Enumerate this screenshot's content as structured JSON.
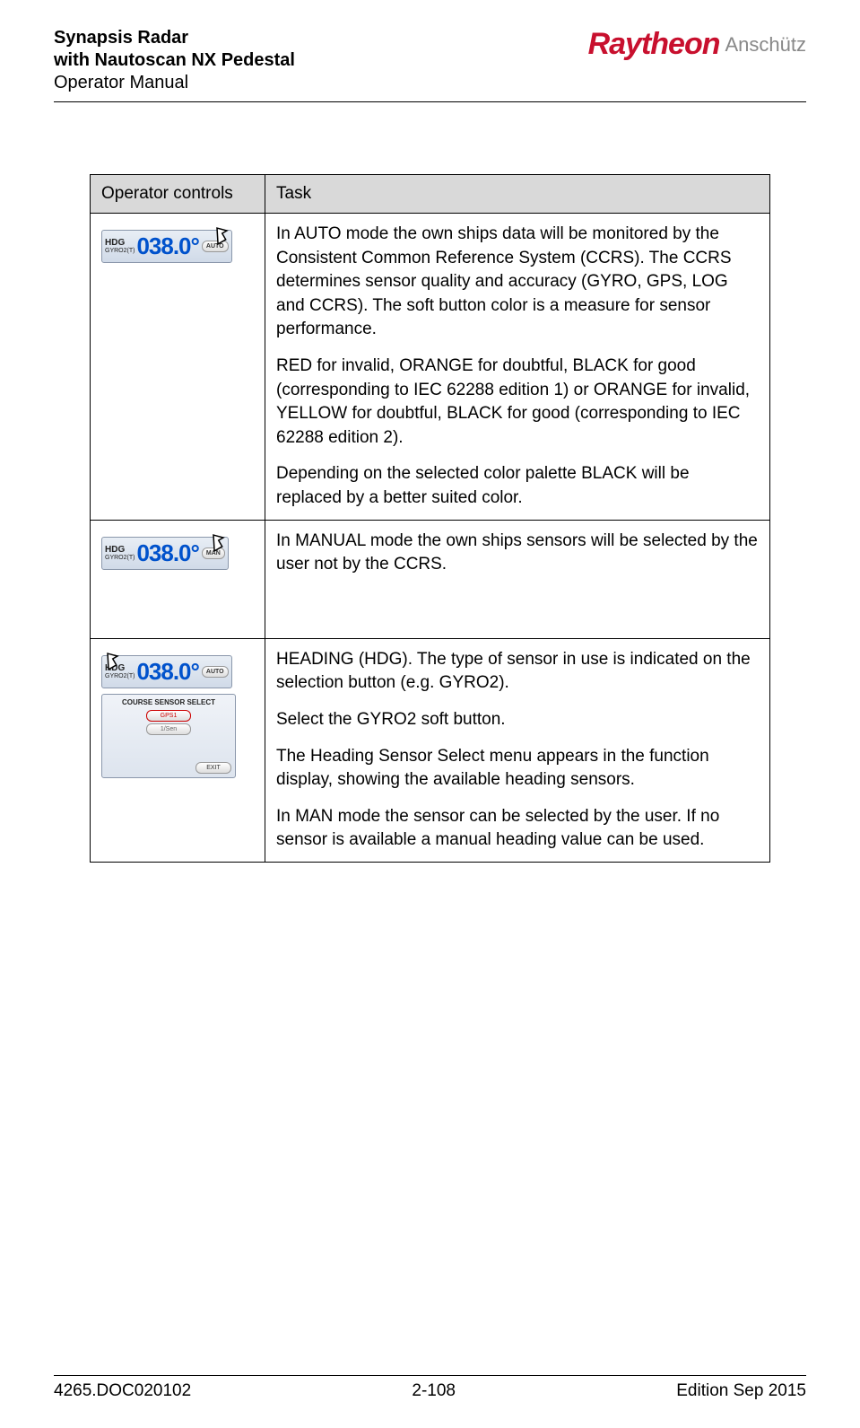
{
  "header": {
    "title_line1": "Synapsis Radar",
    "title_line2": "with Nautoscan NX Pedestal",
    "subtitle": "Operator Manual",
    "brand_main": "Raytheon",
    "brand_sub": "Anschütz"
  },
  "table": {
    "header_col1": "Operator controls",
    "header_col2": "Task",
    "rows": [
      {
        "widget": {
          "hdg_label": "HDG",
          "gyro_label": "GYRO2(T)",
          "value": "038.0°",
          "mode": "AUTO",
          "cursor_pos": "right"
        },
        "task_paragraphs": [
          "In AUTO mode the own ships data will be monitored by the Consistent Common Reference System (CCRS). The CCRS determines sensor quality and accuracy (GYRO, GPS, LOG and CCRS). The soft button color is a measure for sensor performance.",
          "RED for invalid, ORANGE for doubtful, BLACK for good (corresponding to IEC 62288 edition 1) or ORANGE for invalid, YELLOW for doubtful, BLACK for good (corresponding to IEC 62288 edition 2).",
          "Depending on the selected color palette BLACK will be replaced by a better suited color."
        ]
      },
      {
        "widget": {
          "hdg_label": "HDG",
          "gyro_label": "GYRO2(T)",
          "value": "038.0°",
          "mode": "MAN",
          "cursor_pos": "right"
        },
        "task_paragraphs": [
          "In MANUAL mode the own ships sensors will be selected by the user not by the CCRS."
        ]
      },
      {
        "widget": {
          "hdg_label": "HDG",
          "gyro_label": "GYRO2(T)",
          "value": "038.0°",
          "mode": "AUTO",
          "cursor_pos": "left",
          "menu": {
            "title": "COURSE SENSOR SELECT",
            "btn1": "GPS1",
            "btn2": "1/Sen",
            "exit": "EXIT"
          }
        },
        "task_paragraphs": [
          "HEADING (HDG). The type of sensor in use is indicated on the selection button (e.g. GYRO2).",
          "Select the GYRO2 soft button.",
          "The Heading Sensor Select menu appears in the function display, showing the available heading sensors.",
          "In MAN mode the sensor can be selected by the user. If no sensor is available a manual heading value can be used."
        ]
      }
    ]
  },
  "footer": {
    "doc_id": "4265.DOC020102",
    "page": "2-108",
    "edition": "Edition Sep 2015"
  }
}
